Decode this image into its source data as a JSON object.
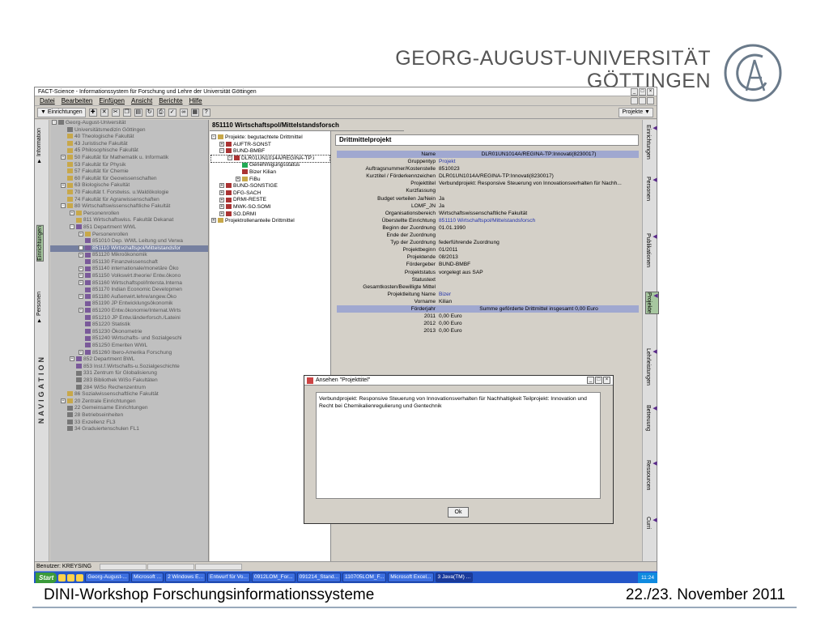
{
  "slide": {
    "uni_line1": "GEORG-AUGUST-UNIVERSITÄT",
    "uni_line2": "GÖTTINGEN",
    "footer_left": "DINI-Workshop Forschungsinformationssysteme",
    "footer_right": "22./23. November 2011"
  },
  "app": {
    "title": "FACT-Science - Informationssystem für Forschung und Lehre der Universität Göttingen",
    "menu": [
      "Datei",
      "Bearbeiten",
      "Einfügen",
      "Ansicht",
      "Berichte",
      "Hilfe"
    ],
    "toolbar_dropdown": "▼ Einrichtungen",
    "projects_dropdown": "Projekte ▼",
    "left_tabs": [
      "Information",
      "Einrichtungen",
      "Personen"
    ],
    "nav_label": "NAVIGATION",
    "tree": [
      {
        "t": "Georg-August-Universität",
        "lvl": 0,
        "ex": "-",
        "icon": "g"
      },
      {
        "t": "Universitätsmedizin Göttingen",
        "lvl": 1,
        "ex": "",
        "icon": "g"
      },
      {
        "t": "40 Theologische Fakultät",
        "lvl": 1,
        "ex": "",
        "icon": "f"
      },
      {
        "t": "43 Juristische Fakultät",
        "lvl": 1,
        "ex": "",
        "icon": "f"
      },
      {
        "t": "45 Philosophische Fakultät",
        "lvl": 1,
        "ex": "",
        "icon": "f"
      },
      {
        "t": "50 Fakultät für Mathematik u. Informatik",
        "lvl": 1,
        "ex": "+",
        "icon": "f"
      },
      {
        "t": "53 Fakultät für Physik",
        "lvl": 1,
        "ex": "",
        "icon": "f"
      },
      {
        "t": "57 Fakultät für Chemie",
        "lvl": 1,
        "ex": "",
        "icon": "f"
      },
      {
        "t": "60 Fakultät für Geowissenschaften",
        "lvl": 1,
        "ex": "",
        "icon": "f"
      },
      {
        "t": "63 Biologische Fakultät",
        "lvl": 1,
        "ex": "+",
        "icon": "f"
      },
      {
        "t": "70 Fakultät f. Forstwiss. u.Waldökologie",
        "lvl": 1,
        "ex": "",
        "icon": "f"
      },
      {
        "t": "74 Fakultät für Agrarwissenschaften",
        "lvl": 1,
        "ex": "",
        "icon": "f"
      },
      {
        "t": "80 Wirtschaftswissenschaftliche Fakultät",
        "lvl": 1,
        "ex": "-",
        "icon": "f"
      },
      {
        "t": "Personenrollen",
        "lvl": 2,
        "ex": "+",
        "icon": "f"
      },
      {
        "t": "811 Wirtschaftswiss. Fakultät Dekanat",
        "lvl": 2,
        "ex": "",
        "icon": "f"
      },
      {
        "t": "851 Department WWL",
        "lvl": 2,
        "ex": "-",
        "icon": "u"
      },
      {
        "t": "Personenrollen",
        "lvl": 3,
        "ex": "+",
        "icon": "f"
      },
      {
        "t": "851010 Dep. WWL Leitung und Verwa",
        "lvl": 3,
        "ex": "",
        "icon": "u"
      },
      {
        "t": "851110 Wirtschaftspol/Mittelstandsfor",
        "lvl": 3,
        "ex": "+",
        "icon": "u",
        "sel": true
      },
      {
        "t": "851120 Mikroökonomik",
        "lvl": 3,
        "ex": "+",
        "icon": "u"
      },
      {
        "t": "851130 Finanzwissenschaft",
        "lvl": 3,
        "ex": "",
        "icon": "u"
      },
      {
        "t": "851140 internationale/monetäre Öko",
        "lvl": 3,
        "ex": "+",
        "icon": "u"
      },
      {
        "t": "851150 Volkswirt.theorie/ Entw.ökono",
        "lvl": 3,
        "ex": "+",
        "icon": "u"
      },
      {
        "t": "851160 Wirtschaftspol/Intersta.Interna",
        "lvl": 3,
        "ex": "+",
        "icon": "u"
      },
      {
        "t": "851170 Indian Economic Developmen",
        "lvl": 3,
        "ex": "",
        "icon": "u"
      },
      {
        "t": "851180 Außenwirt.lehre/angew.Öko",
        "lvl": 3,
        "ex": "+",
        "icon": "u"
      },
      {
        "t": "851190 JP Entwicklungsökonomik",
        "lvl": 3,
        "ex": "",
        "icon": "u"
      },
      {
        "t": "851200 Entw.ökonomie/Internat.Wirts",
        "lvl": 3,
        "ex": "+",
        "icon": "u"
      },
      {
        "t": "851210 JP Entw.länderforsch./Lateini",
        "lvl": 3,
        "ex": "",
        "icon": "u"
      },
      {
        "t": "851220 Statistik",
        "lvl": 3,
        "ex": "",
        "icon": "u"
      },
      {
        "t": "851230 Ökonometrie",
        "lvl": 3,
        "ex": "",
        "icon": "u"
      },
      {
        "t": "851240 Wirtschafts- und Sozialgeschi",
        "lvl": 3,
        "ex": "",
        "icon": "u"
      },
      {
        "t": "851250 Emeriten WWL",
        "lvl": 3,
        "ex": "",
        "icon": "u"
      },
      {
        "t": "851260 Ibero-Amerika Forschung",
        "lvl": 3,
        "ex": "+",
        "icon": "u"
      },
      {
        "t": "852 Department BWL",
        "lvl": 2,
        "ex": "+",
        "icon": "u"
      },
      {
        "t": "853 Inst.f.Wirtschafts-u.Sozialgeschichte",
        "lvl": 2,
        "ex": "",
        "icon": "u"
      },
      {
        "t": "331 Zentrum für Globalisierung",
        "lvl": 2,
        "ex": "",
        "icon": "g"
      },
      {
        "t": "283 Bibliothek WiSo Fakultäten",
        "lvl": 2,
        "ex": "",
        "icon": "g"
      },
      {
        "t": "284 WiSo Rechenzentrum",
        "lvl": 2,
        "ex": "",
        "icon": "g"
      },
      {
        "t": "86 Sozialwissenschaftliche Fakultät",
        "lvl": 1,
        "ex": "",
        "icon": "f"
      },
      {
        "t": "20 Zentrale Einrichtungen",
        "lvl": 1,
        "ex": "+",
        "icon": "f"
      },
      {
        "t": "22 Gemeinsame Einrichtungen",
        "lvl": 1,
        "ex": "",
        "icon": "g"
      },
      {
        "t": "28 Betriebseinheiten",
        "lvl": 1,
        "ex": "",
        "icon": "g"
      },
      {
        "t": "33 Exzellenz FL3",
        "lvl": 1,
        "ex": "",
        "icon": "g"
      },
      {
        "t": "34 Graduiertenschulen FL1",
        "lvl": 1,
        "ex": "",
        "icon": "g"
      }
    ],
    "mid_header": "851110 Wirtschaftspol/Mittelstandsforsch",
    "mid_tree": [
      {
        "t": "Projekte: begutachtete Drittmittel",
        "lvl": 0,
        "ex": "-",
        "icon": "f"
      },
      {
        "t": "AUFTR-SONST",
        "lvl": 1,
        "ex": "+",
        "icon": "r"
      },
      {
        "t": "BUND-BMBF",
        "lvl": 1,
        "ex": "-",
        "icon": "r"
      },
      {
        "t": "DLR01UN1014A/REGINA-TP:i",
        "lvl": 2,
        "ex": "-",
        "icon": "r",
        "sel": true
      },
      {
        "t": "Genehmigungsstatus",
        "lvl": 3,
        "ex": "",
        "icon": "c"
      },
      {
        "t": "Bizer Kilian",
        "lvl": 3,
        "ex": "",
        "icon": "r"
      },
      {
        "t": "FiBu",
        "lvl": 3,
        "ex": "+",
        "icon": "f"
      },
      {
        "t": "BUND-SONSTIGE",
        "lvl": 1,
        "ex": "+",
        "icon": "r"
      },
      {
        "t": "DFG-SACH",
        "lvl": 1,
        "ex": "+",
        "icon": "r"
      },
      {
        "t": "DRMI-RESTE",
        "lvl": 1,
        "ex": "+",
        "icon": "r"
      },
      {
        "t": "MWK-SO.SOMI",
        "lvl": 1,
        "ex": "+",
        "icon": "r"
      },
      {
        "t": "SO.DRMI",
        "lvl": 1,
        "ex": "+",
        "icon": "r"
      },
      {
        "t": "Projektrollenanteile Drittmittel",
        "lvl": 0,
        "ex": "+",
        "icon": "f"
      }
    ],
    "detail_header": "Drittmittelprojekt",
    "detail_rows": [
      {
        "k": "Name",
        "v": "DLR01UN1014A/REGINA-TP:Innovati(8230017)",
        "hl": true
      },
      {
        "k": "Gruppentyp",
        "v": "Projekt",
        "link": true
      },
      {
        "k": "Auftragsnummer/Kostenstelle",
        "v": "8510023"
      },
      {
        "k": "Kurztitel / Förderkennzeichen",
        "v": "DLR01UN1014A/REGINA-TP:Innovati(8230017)"
      },
      {
        "k": "Projekttitel",
        "v": "Verbundprojekt: Responsive Steuerung von Innovationsverhalten für Nachh..."
      },
      {
        "k": "Kurzfassung",
        "v": ""
      },
      {
        "k": "Budget verteilen Ja/Nein",
        "v": "Ja"
      },
      {
        "k": "LOMF_JN",
        "v": "Ja"
      },
      {
        "k": "Organisationsbereich",
        "v": "Wirtschaftswissenschaftliche Fakultät"
      },
      {
        "k": "Überstellte Einrichtung",
        "v": "851110 Wirtschaftspol/Mittelstandsforsch",
        "link": true
      },
      {
        "k": "Beginn der Zuordnung",
        "v": "01.01.1990"
      },
      {
        "k": "Ende der Zuordnung",
        "v": ""
      },
      {
        "k": "Typ der Zuordnung",
        "v": "federführende Zuordnung"
      },
      {
        "k": "Projektbeginn",
        "v": "01/2011"
      },
      {
        "k": "Projektende",
        "v": "08/2013"
      },
      {
        "k": "Fördergeber",
        "v": "BUND-BMBF"
      },
      {
        "k": "Projektstatus",
        "v": "vorgelegt aus SAP"
      },
      {
        "k": "Statustext",
        "v": ""
      },
      {
        "k": "Gesamtkosten/Bewilligte Mittel",
        "v": ""
      },
      {
        "k": "Projektleitung Name",
        "v": "Bizer",
        "link": true
      },
      {
        "k": "Vorname",
        "v": "Kilian"
      },
      {
        "k": "Förderjahr",
        "v": "Summe geförderte Drittmittel insgesamt 0,00 Euro",
        "hl": true
      },
      {
        "k": "2011",
        "v": "0,00 Euro"
      },
      {
        "k": "2012",
        "v": "0,00 Euro"
      },
      {
        "k": "2013",
        "v": "0,00 Euro"
      }
    ],
    "right_tabs": [
      "Einrichtungen",
      "Personen",
      "Publikationen",
      "Projekte",
      "Lehrleistungen",
      "Betreuung",
      "Ressourcen",
      "Curri"
    ],
    "status_user": "Benutzer: KREYSING"
  },
  "dialog": {
    "title": "Ansehen \"Projekttitel\"",
    "text": "Verbundprojekt: Responsive Steuerung von Innovationsverhalten für Nachhaltigkeit Teilprojekt: Innovation und Recht bei Chemikalienregulierung und Gentechnik",
    "ok": "Ok"
  },
  "taskbar": {
    "start": "Start",
    "items": [
      "Georg-August-...",
      "Microsoft ...",
      "2 Windows E...",
      "Entwurf für Vo...",
      "0912LOM_For...",
      "091214_Stand...",
      "110705LOM_F...",
      "Microsoft Excel...",
      "3 Java(TM) ..."
    ],
    "active_index": 8,
    "clock": "11:24"
  }
}
